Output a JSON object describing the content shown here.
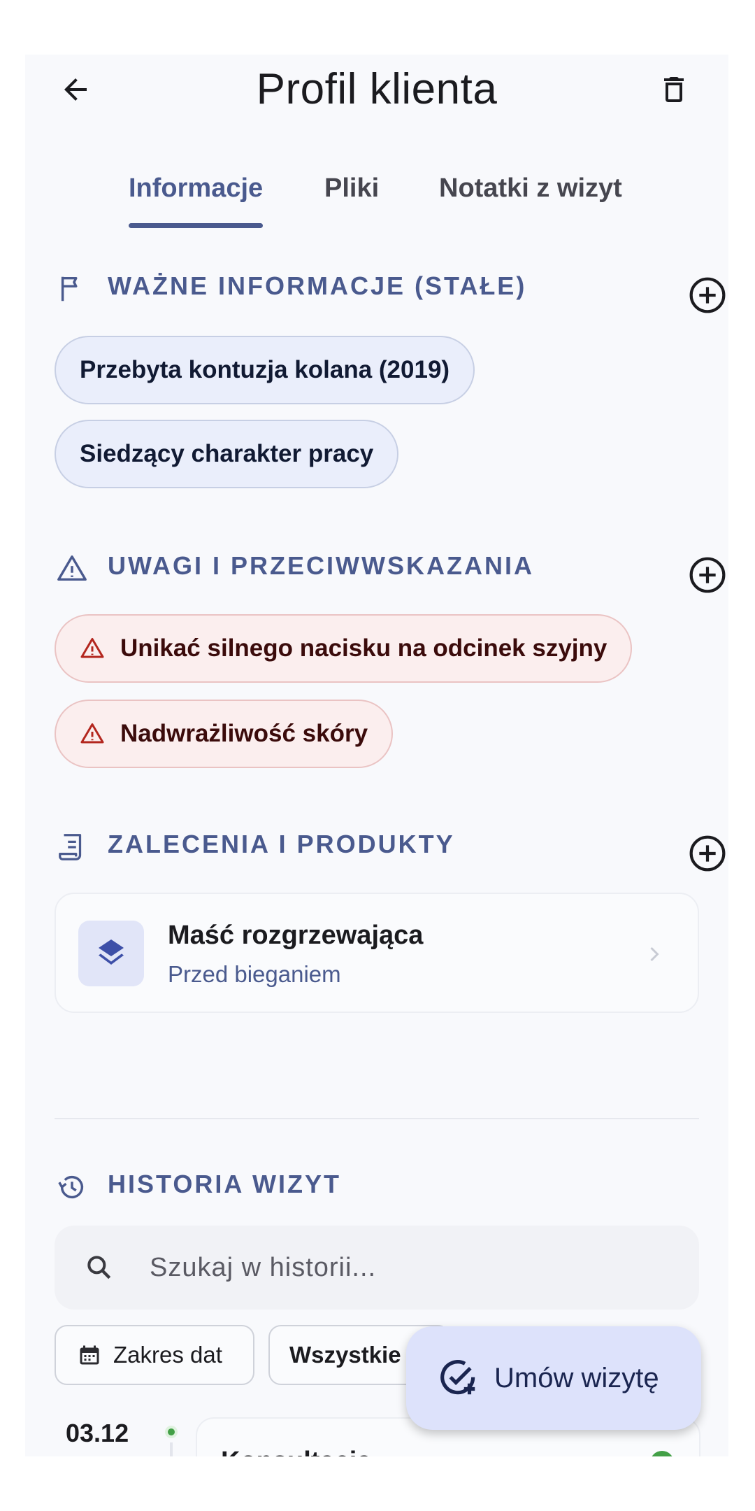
{
  "header": {
    "title": "Profil klienta"
  },
  "tabs": [
    {
      "label": "Informacje",
      "active": true
    },
    {
      "label": "Pliki",
      "active": false
    },
    {
      "label": "Notatki z wizyt",
      "active": false
    }
  ],
  "important": {
    "title": "WAŻNE INFORMACJE (STAŁE)",
    "items": [
      "Przebyta kontuzja kolana (2019)",
      "Siedzący charakter pracy"
    ]
  },
  "warnings": {
    "title": "UWAGI I PRZECIWWSKAZANIA",
    "items": [
      "Unikać silnego nacisku na odcinek szyjny",
      "Nadwrażliwość skóry"
    ]
  },
  "recommendations": {
    "title": "ZALECENIA I PRODUKTY",
    "items": [
      {
        "name": "Maść rozgrzewająca",
        "subtitle": "Przed bieganiem"
      }
    ]
  },
  "history": {
    "title": "HISTORIA WIZYT",
    "search_placeholder": "Szukaj w historii...",
    "filters": {
      "date_range": "Zakres dat",
      "status": "Wszystkie"
    },
    "entries": [
      {
        "date": "03.12",
        "title": "Konsultacja"
      }
    ]
  },
  "fab": {
    "label": "Umów wizytę"
  },
  "colors": {
    "accent": "#4a5a8e",
    "chip_info_bg": "#eaeefb",
    "chip_warn_bg": "#fbeeee",
    "warn_icon": "#b3261e",
    "fab_bg": "#dde2fb",
    "status_ok": "#43a047"
  }
}
